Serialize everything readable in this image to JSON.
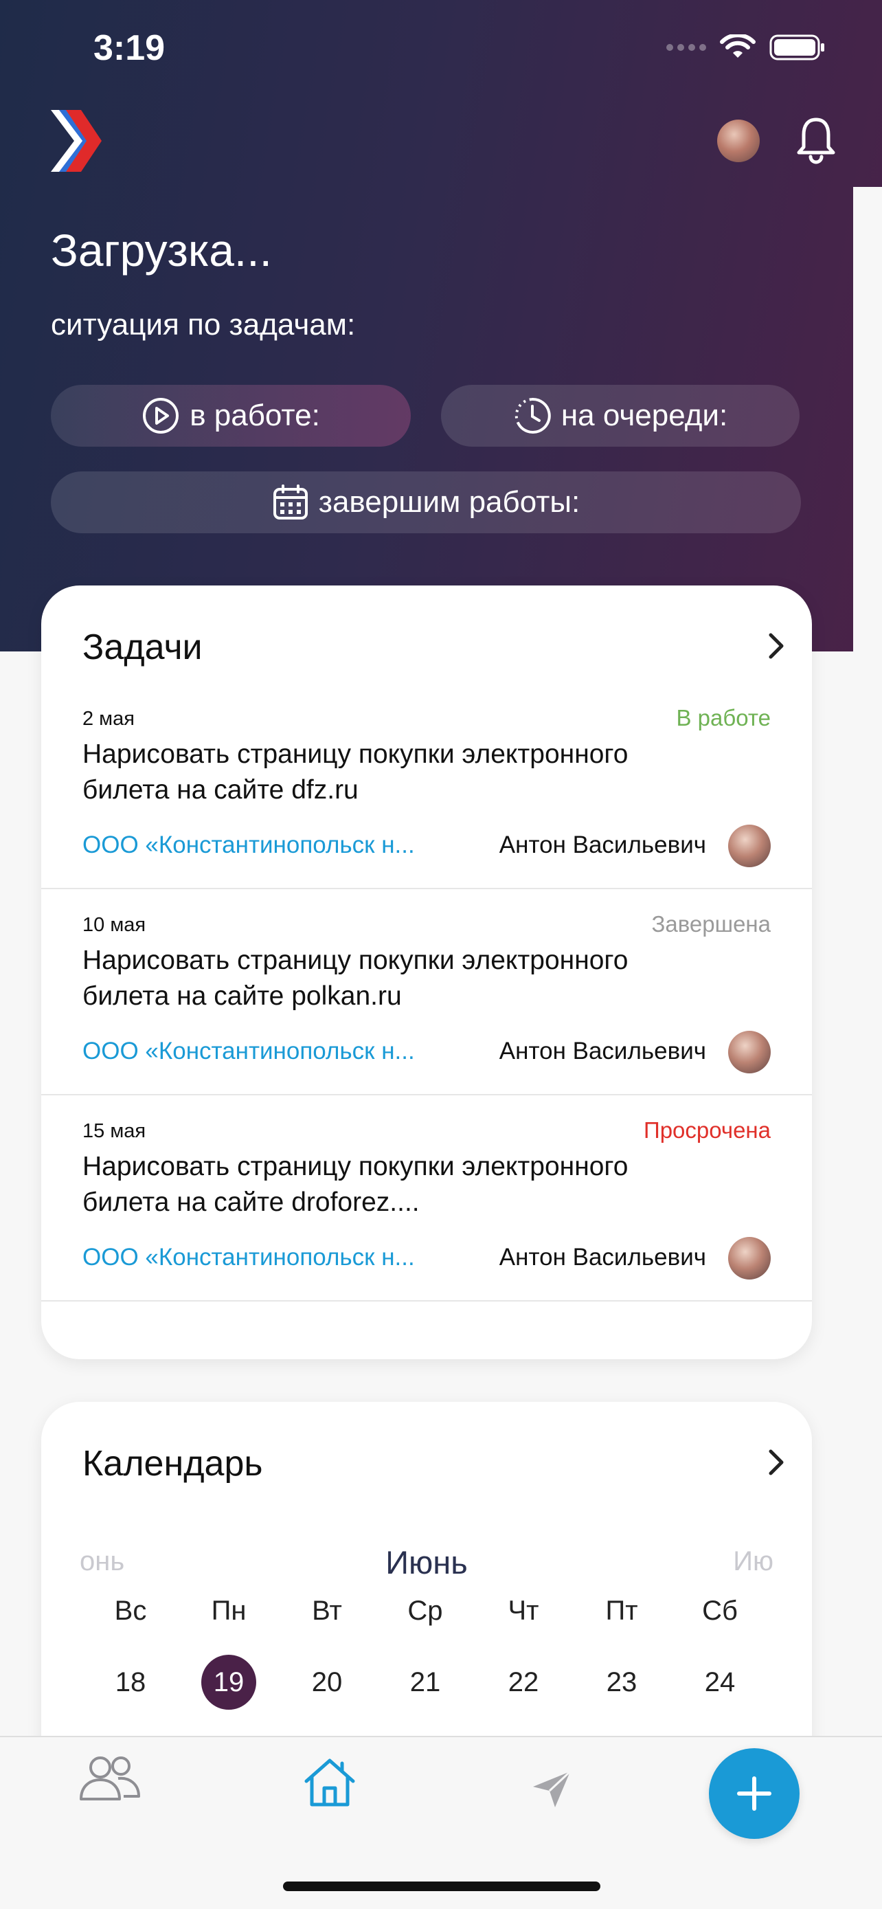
{
  "status_bar": {
    "time": "3:19"
  },
  "header": {
    "title": "Загрузка...",
    "subtitle": "ситуация по задачам:",
    "pills": {
      "in_work": "в работе:",
      "in_queue": "на очереди:",
      "finish": "завершим работы:"
    },
    "icons": [
      "logo-chevron-icon",
      "avatar",
      "bell-icon"
    ]
  },
  "tasks_card": {
    "title": "Задачи",
    "items": [
      {
        "date": "2 мая",
        "status": "В работе",
        "status_color": "#6fb254",
        "title": "Нарисовать страницу покупки электронного билета на сайте dfz.ru",
        "company": "ООО «Константинопольск н...",
        "person": "Антон Васильевич"
      },
      {
        "date": "10 мая",
        "status": "Завершена",
        "status_color": "#9a9a9a",
        "title": "Нарисовать страницу покупки электронного билета на сайте polkan.ru",
        "company": "ООО «Константинопольск н...",
        "person": "Антон Васильевич"
      },
      {
        "date": "15 мая",
        "status": "Просрочена",
        "status_color": "#e0302a",
        "title": "Нарисовать страницу покупки электронного билета на сайте droforez....",
        "company": "ООО «Константинопольск н...",
        "person": "Антон Васильевич"
      }
    ]
  },
  "calendar_card": {
    "title": "Календарь",
    "month_prev": "онь",
    "month": "Июнь",
    "month_next": "Ию",
    "weekdays": [
      "Вс",
      "Пн",
      "Вт",
      "Ср",
      "Чт",
      "Пт",
      "Сб"
    ],
    "days": [
      "18",
      "19",
      "20",
      "21",
      "22",
      "23",
      "24"
    ],
    "selected_day": "19"
  },
  "tab_bar": {
    "items": [
      "people-icon",
      "home-icon",
      "send-icon"
    ],
    "active": "home-icon",
    "fab": "plus-icon"
  },
  "colors": {
    "accent": "#1a9ad6",
    "hero_start": "#1f2b49",
    "hero_end": "#4a2248",
    "selected_day": "#4a2148"
  }
}
